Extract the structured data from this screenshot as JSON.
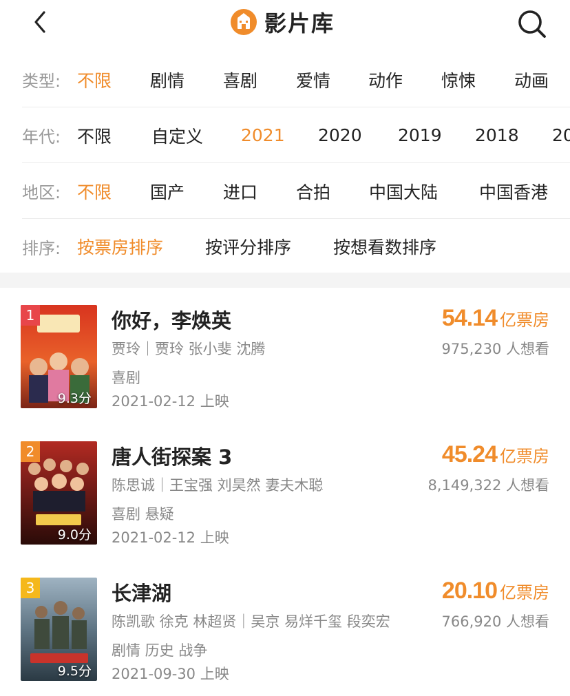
{
  "header": {
    "title": "影片库"
  },
  "filters": [
    {
      "label": "类型:",
      "options": [
        "不限",
        "剧情",
        "喜剧",
        "爱情",
        "动作",
        "惊悚",
        "动画"
      ],
      "active": 0
    },
    {
      "label": "年代:",
      "options": [
        "不限",
        "自定义",
        "2021",
        "2020",
        "2019",
        "2018",
        "20"
      ],
      "active": 2
    },
    {
      "label": "地区:",
      "options": [
        "不限",
        "国产",
        "进口",
        "合拍",
        "中国大陆",
        "中国香港"
      ],
      "active": 0
    },
    {
      "label": "排序:",
      "options": [
        "按票房排序",
        "按评分排序",
        "按想看数排序"
      ],
      "active": 0
    }
  ],
  "colors": {
    "accent": "#f08c2b",
    "rank1": "#e8464a",
    "rank2": "#f08c2b",
    "rank3": "#f5b81c"
  },
  "movies": [
    {
      "rank": "1",
      "score": "9.3分",
      "title": "你好，李焕英",
      "credit": "贾玲｜贾玲 张小斐 沈腾",
      "genre": "喜剧",
      "date": "2021-02-12 上映",
      "box": "54.14",
      "box_unit": "亿票房",
      "want": "975,230 人想看"
    },
    {
      "rank": "2",
      "score": "9.0分",
      "title": "唐人街探案 3",
      "credit": "陈思诚｜王宝强 刘昊然 妻夫木聪",
      "genre": "喜剧 悬疑",
      "date": "2021-02-12 上映",
      "box": "45.24",
      "box_unit": "亿票房",
      "want": "8,149,322 人想看"
    },
    {
      "rank": "3",
      "score": "9.5分",
      "title": "长津湖",
      "credit": "陈凯歌 徐克 林超贤｜吴京 易烊千玺 段奕宏",
      "genre": "剧情 历史 战争",
      "date": "2021-09-30 上映",
      "box": "20.10",
      "box_unit": "亿票房",
      "want": "766,920 人想看"
    }
  ]
}
